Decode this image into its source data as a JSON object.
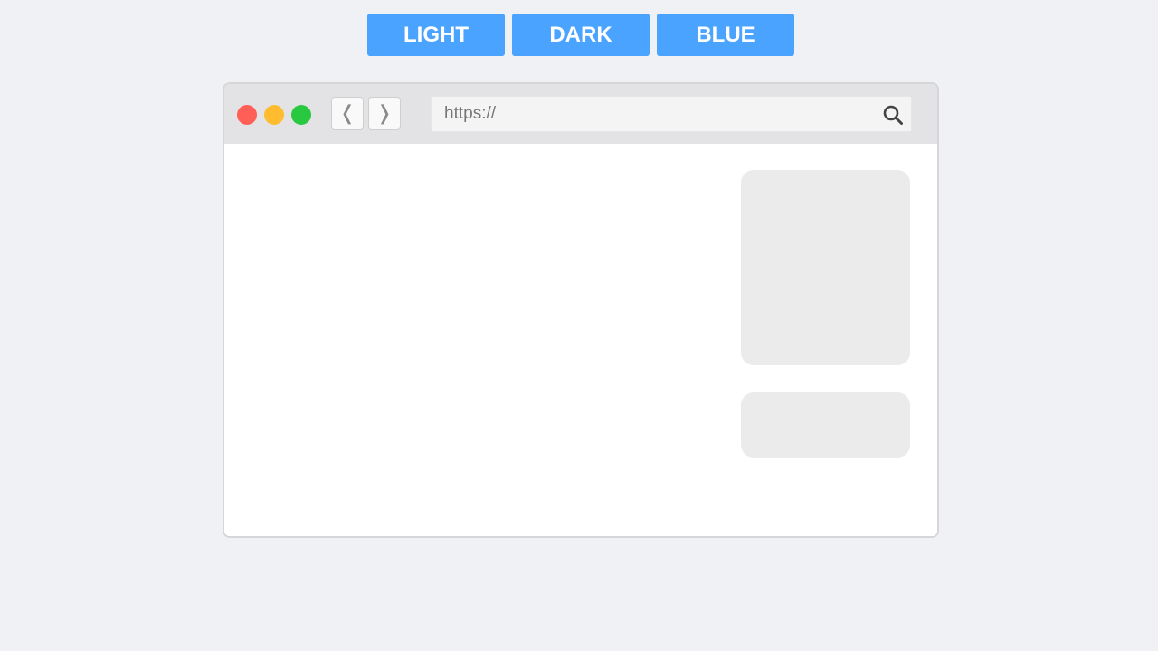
{
  "theme_switcher": {
    "buttons": [
      {
        "label": "LIGHT"
      },
      {
        "label": "DARK"
      },
      {
        "label": "BLUE"
      }
    ],
    "accent_color": "#4aa3ff"
  },
  "browser": {
    "traffic_lights": {
      "close_color": "#ff5f57",
      "minimize_color": "#febc2e",
      "maximize_color": "#28c840"
    },
    "nav": {
      "back_glyph": "❬",
      "forward_glyph": "❭"
    },
    "address_bar": {
      "placeholder": "https://",
      "value": ""
    },
    "icons": {
      "search": "search-icon"
    }
  }
}
